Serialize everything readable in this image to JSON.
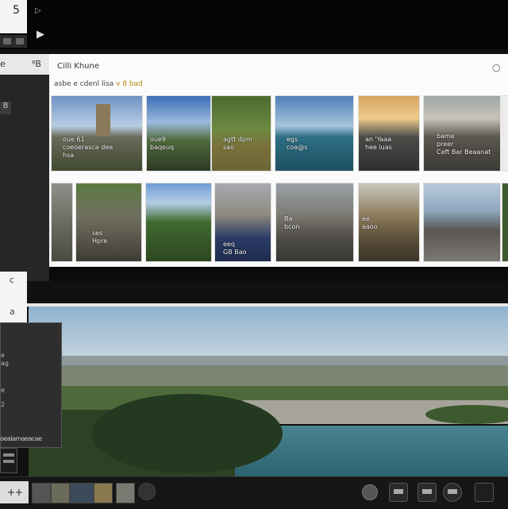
{
  "top": {
    "box_glyph": "5",
    "mini_play_icon": "play-icon",
    "main_play_icon": "play-icon"
  },
  "left_panel": {
    "header_left": "e",
    "header_right": "⁸B",
    "row_label": "B"
  },
  "gallery": {
    "title": "Cilli Khune",
    "search_icon": "search-icon",
    "breadcrumb": "asbe e cdenl lisa",
    "breadcrumb_accent": "v 8 bad",
    "row1": [
      {
        "caption": "oue 61\ncoeoerasca dee\nhsa"
      },
      {
        "caption": "oue9\nbaqeuq"
      },
      {
        "caption": "agtt dpm\nsao"
      },
      {
        "caption": "egs\ncoa@s"
      },
      {
        "caption": "an 'Yaaa\nhee iuas"
      },
      {
        "caption": "bame\npreer\nCeft Bar Beaanat"
      },
      {
        "caption": ""
      }
    ],
    "row2": [
      {
        "caption": ""
      },
      {
        "caption": "ses\nHpre"
      },
      {
        "caption": ""
      },
      {
        "caption": "eeq\nGB Bao"
      },
      {
        "caption": "Ba\nbcon"
      },
      {
        "caption": "ee\naaoo"
      },
      {
        "caption": ""
      },
      {
        "caption": ""
      }
    ]
  },
  "left_block": {
    "top_glyph": "c",
    "bottom_glyph": "a"
  },
  "inspector": {
    "lines": [
      "e",
      "ag",
      "e",
      "2"
    ],
    "bottom_label": "oealamaeacae"
  },
  "bottom_bar": {
    "add_label": "+ +",
    "clip_count": 6,
    "circle_icon": "record-icon",
    "buttons": [
      "export-icon",
      "settings-icon",
      "audio-icon"
    ]
  },
  "colors": {
    "panel_bg": "#262626",
    "gallery_bg": "#fbfbfb",
    "accent": "#b8860b"
  }
}
